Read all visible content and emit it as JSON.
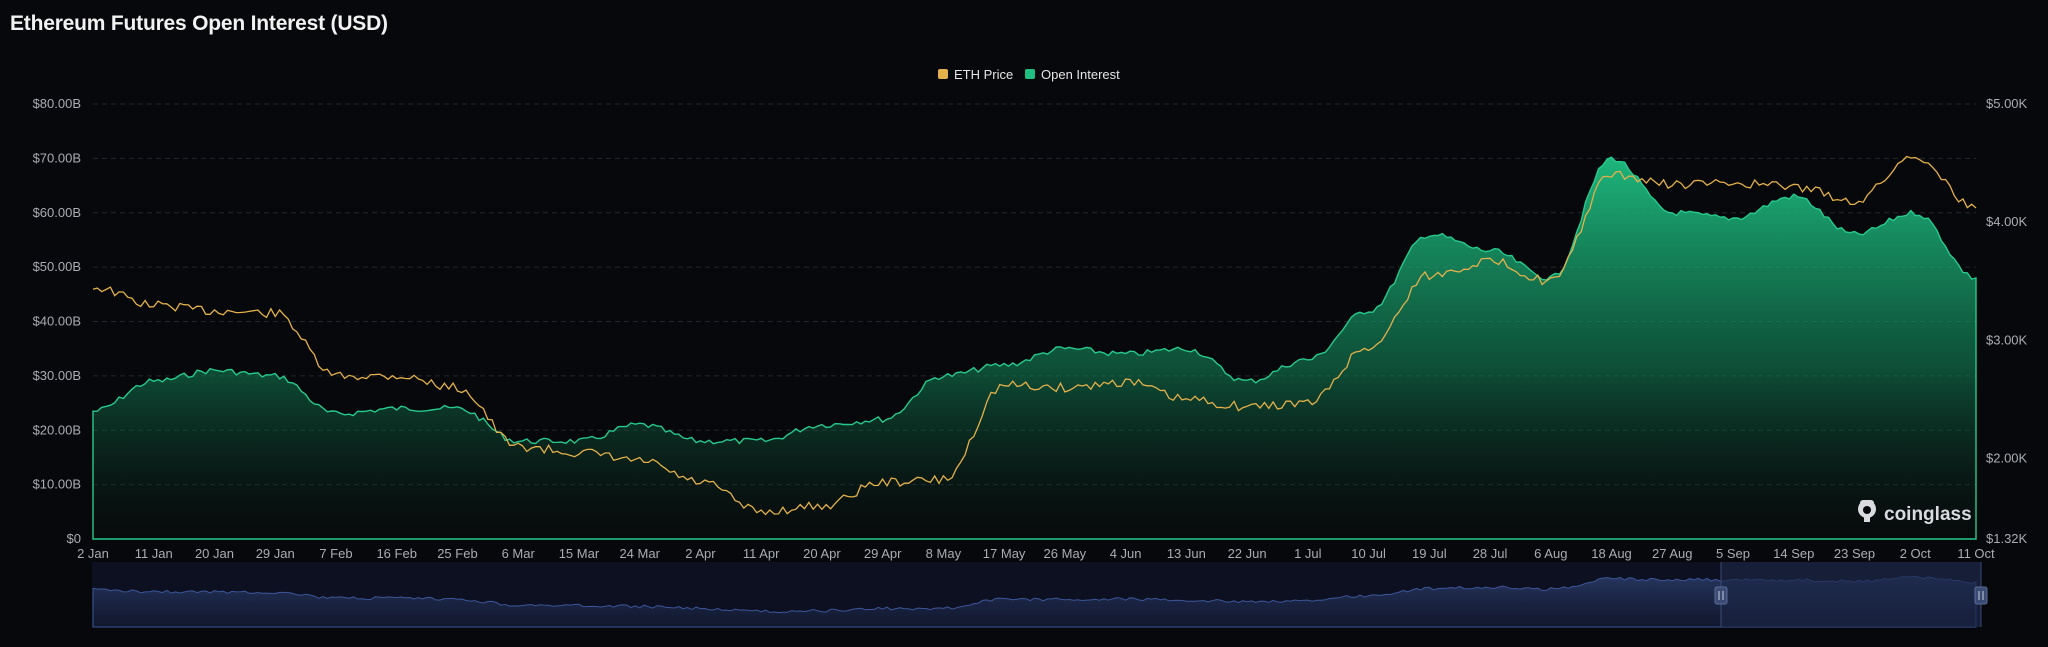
{
  "page": {
    "title": "Ethereum Futures Open Interest (USD)"
  },
  "brand": {
    "name": "coinglass"
  },
  "colors": {
    "background": "#07080b",
    "price": "#e3b04b",
    "open_interest": "#1fbf83",
    "grid": "#23262d",
    "navigator": "#2a3a66"
  },
  "chart_data": {
    "type": "area",
    "title": "Ethereum Futures Open Interest (USD)",
    "legend": [
      "ETH Price",
      "Open Interest"
    ],
    "legend_position": "top-center",
    "grid": true,
    "x_ticks": [
      "2 Jan",
      "11 Jan",
      "20 Jan",
      "29 Jan",
      "7 Feb",
      "16 Feb",
      "25 Feb",
      "6 Mar",
      "15 Mar",
      "24 Mar",
      "2 Apr",
      "11 Apr",
      "20 Apr",
      "29 Apr",
      "8 May",
      "17 May",
      "26 May",
      "4 Jun",
      "13 Jun",
      "22 Jun",
      "1 Jul",
      "10 Jul",
      "19 Jul",
      "28 Jul",
      "6 Aug",
      "18 Aug",
      "27 Aug",
      "5 Sep",
      "14 Sep",
      "23 Sep",
      "2 Oct",
      "11 Oct"
    ],
    "y_left": {
      "label": "Open Interest",
      "ticks": [
        "$0",
        "$10.00B",
        "$20.00B",
        "$30.00B",
        "$40.00B",
        "$50.00B",
        "$60.00B",
        "$70.00B",
        "$80.00B"
      ],
      "range": [
        0,
        80
      ]
    },
    "y_right": {
      "label": "ETH Price",
      "ticks": [
        "$1.32K",
        "$2.00K",
        "$3.00K",
        "$4.00K",
        "$5.00K"
      ],
      "range": [
        1320,
        5000
      ]
    },
    "series": [
      {
        "name": "Open Interest",
        "unit": "B USD",
        "x": [
          "2 Jan",
          "11 Jan",
          "20 Jan",
          "29 Jan",
          "7 Feb",
          "16 Feb",
          "25 Feb",
          "6 Mar",
          "15 Mar",
          "24 Mar",
          "2 Apr",
          "11 Apr",
          "20 Apr",
          "29 Apr",
          "8 May",
          "17 May",
          "26 May",
          "4 Jun",
          "13 Jun",
          "22 Jun",
          "1 Jul",
          "10 Jul",
          "19 Jul",
          "28 Jul",
          "6 Aug",
          "18 Aug",
          "27 Aug",
          "5 Sep",
          "14 Sep",
          "23 Sep",
          "2 Oct",
          "11 Oct"
        ],
        "values": [
          23.5,
          29,
          31,
          30,
          23,
          24,
          24,
          18,
          18,
          21,
          18,
          18,
          21,
          22,
          30,
          32,
          35,
          34,
          35,
          29,
          33,
          42,
          56,
          53,
          48,
          70,
          60,
          59,
          63,
          56,
          60,
          48
        ]
      },
      {
        "name": "ETH Price",
        "unit": "USD",
        "x": [
          "2 Jan",
          "11 Jan",
          "20 Jan",
          "29 Jan",
          "7 Feb",
          "16 Feb",
          "25 Feb",
          "6 Mar",
          "15 Mar",
          "24 Mar",
          "2 Apr",
          "11 Apr",
          "20 Apr",
          "29 Apr",
          "8 May",
          "17 May",
          "26 May",
          "4 Jun",
          "13 Jun",
          "22 Jun",
          "1 Jul",
          "10 Jul",
          "19 Jul",
          "28 Jul",
          "6 Aug",
          "18 Aug",
          "27 Aug",
          "5 Sep",
          "14 Sep",
          "23 Sep",
          "2 Oct",
          "11 Oct"
        ],
        "values": [
          3450,
          3300,
          3250,
          3230,
          2700,
          2700,
          2600,
          2100,
          2050,
          1980,
          1800,
          1550,
          1600,
          1800,
          1820,
          2620,
          2600,
          2650,
          2500,
          2440,
          2470,
          2940,
          3550,
          3670,
          3500,
          4400,
          4320,
          4330,
          4300,
          4180,
          4560,
          4120
        ]
      }
    ]
  }
}
